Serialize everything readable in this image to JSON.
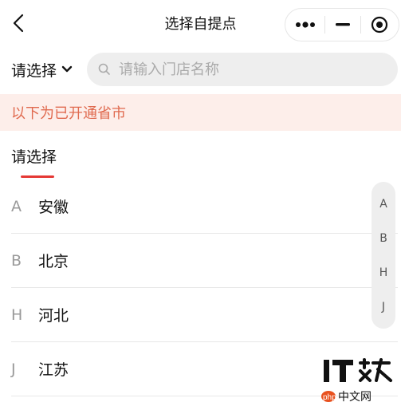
{
  "header": {
    "title": "选择自提点",
    "back_icon": "chevron-left-icon",
    "capsule": {
      "more_icon": "more-dots-icon",
      "minimize_icon": "minimize-icon",
      "close_icon": "target-close-icon"
    }
  },
  "search": {
    "region_label": "请选择",
    "region_icon": "chevron-down-icon",
    "placeholder": "请输入门店名称",
    "value": ""
  },
  "notice": {
    "text": "以下为已开通省市"
  },
  "tab": {
    "label": "请选择",
    "underline_color": "#e53935"
  },
  "provinces": [
    {
      "letter": "A",
      "name": "安徽"
    },
    {
      "letter": "B",
      "name": "北京"
    },
    {
      "letter": "H",
      "name": "河北"
    },
    {
      "letter": "J",
      "name": "江苏"
    }
  ],
  "index": [
    "A",
    "B",
    "H",
    "J"
  ],
  "watermark": {
    "top_text": "IT之家",
    "bottom_text": "php中文网"
  },
  "colors": {
    "notice_bg": "#fdeeea",
    "notice_text": "#e06a4f",
    "accent": "#e53935"
  }
}
